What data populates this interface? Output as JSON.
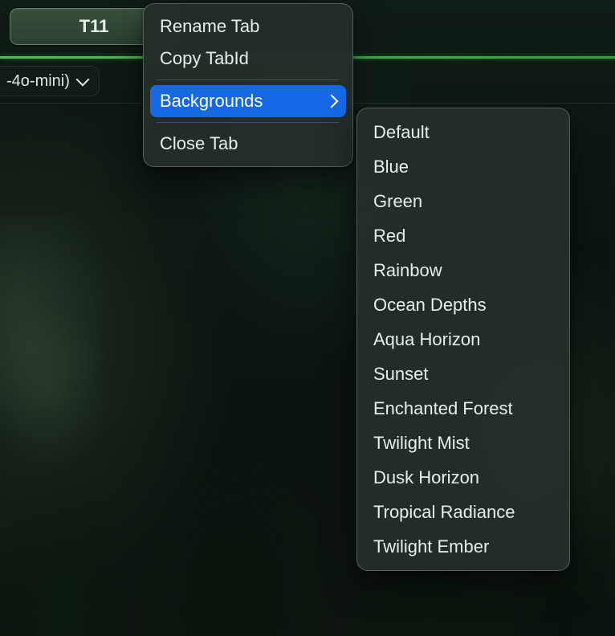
{
  "tab": {
    "label": "T11"
  },
  "model_chip": {
    "label": "-4o-mini)"
  },
  "context_menu": {
    "items": [
      {
        "label": "Rename Tab",
        "has_submenu": false
      },
      {
        "label": "Copy TabId",
        "has_submenu": false
      },
      {
        "label": "Backgrounds",
        "has_submenu": true,
        "selected": true
      },
      {
        "label": "Close Tab",
        "has_submenu": false
      }
    ]
  },
  "backgrounds_submenu": {
    "items": [
      "Default",
      "Blue",
      "Green",
      "Red",
      "Rainbow",
      "Ocean Depths",
      "Aqua Horizon",
      "Sunset",
      "Enchanted Forest",
      "Twilight Mist",
      "Dusk Horizon",
      "Tropical Radiance",
      "Twilight Ember"
    ]
  },
  "colors": {
    "accent_green": "#3ab94a",
    "selection_blue": "#1768e5",
    "menu_bg": "#2b342f"
  }
}
